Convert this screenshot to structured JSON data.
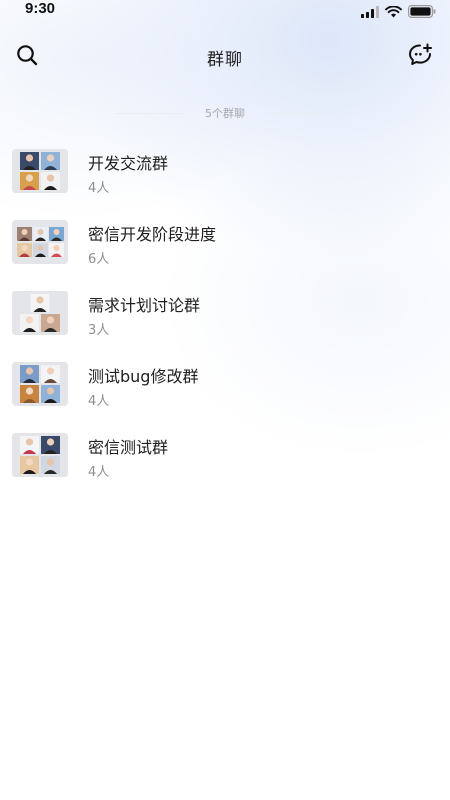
{
  "status_bar": {
    "time": "9:30",
    "icons": [
      "signal-icon",
      "wifi-icon",
      "battery-icon"
    ]
  },
  "header": {
    "title": "群聊",
    "left_icon": "search-icon",
    "right_icon": "add-group-chat-icon"
  },
  "summary": {
    "count_text": "5个群聊"
  },
  "groups": [
    {
      "name": "开发交流群",
      "members": "4人"
    },
    {
      "name": "密信开发阶段进度",
      "members": "6人"
    },
    {
      "name": "需求计划讨论群",
      "members": "3人"
    },
    {
      "name": "测试bug修改群",
      "members": "4人"
    },
    {
      "name": "密信测试群",
      "members": "4人"
    }
  ],
  "colors": {
    "title": "#222222",
    "subtext": "#8c8f94",
    "divider": "#ebedf0",
    "avatar_bg": "#e3e5e8"
  }
}
